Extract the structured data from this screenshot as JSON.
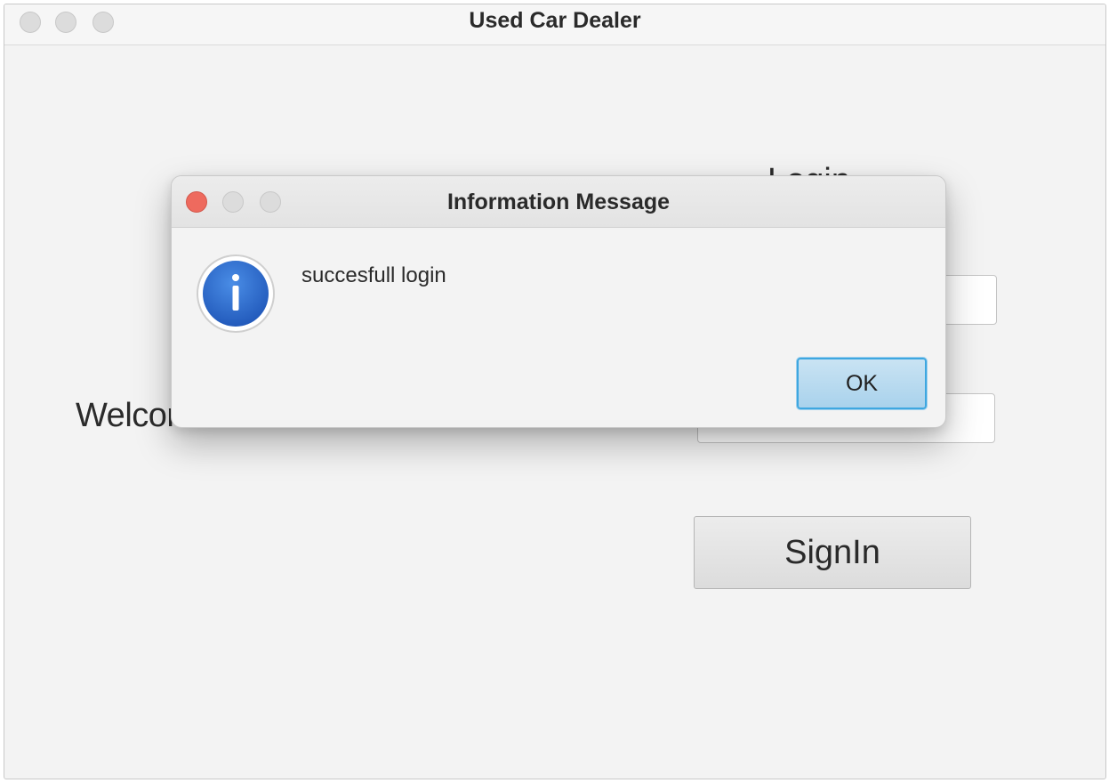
{
  "main_window": {
    "title": "Used Car Dealer",
    "welcome_text": "Welcome to Used Car Dealer",
    "login_heading": "Login",
    "signin_label": "SignIn"
  },
  "dialog": {
    "title": "Information Message",
    "message": "succesfull login",
    "ok_label": "OK",
    "icon": "info-icon",
    "icon_color": "#2f6fd1"
  },
  "colors": {
    "window_background": "#f3f3f3",
    "close_button": "#ee6a5e",
    "ok_button_border": "#3ea7e0"
  }
}
